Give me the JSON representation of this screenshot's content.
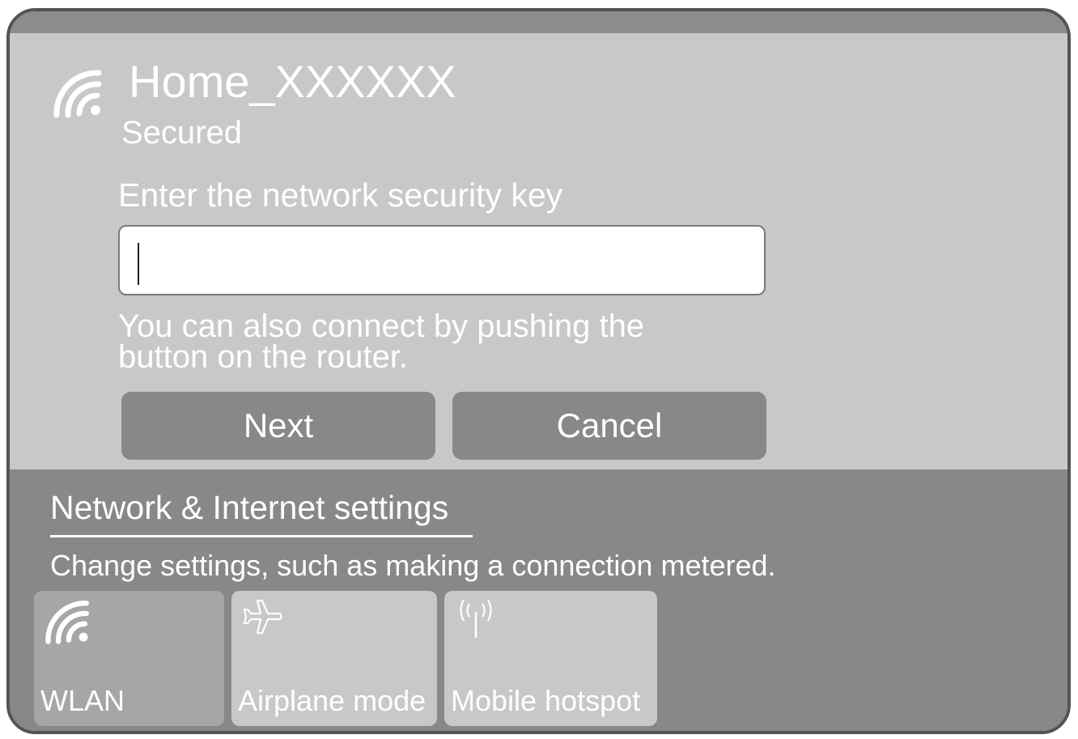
{
  "network": {
    "ssid": "Home_XXXXXX",
    "status": "Secured",
    "prompt": "Enter the network security key",
    "key_value": "",
    "hint": "You can also connect by pushing the button on the router.",
    "icon": "wifi-icon"
  },
  "buttons": {
    "next_label": "Next",
    "cancel_label": "Cancel"
  },
  "settings": {
    "link_label": "Network & Internet settings",
    "description": "Change settings, such as making a connection metered."
  },
  "quick_actions": [
    {
      "label": "WLAN",
      "icon": "wifi-icon",
      "active": true
    },
    {
      "label": "Airplane mode",
      "icon": "airplane-icon",
      "active": false
    },
    {
      "label": "Mobile hotspot",
      "icon": "hotspot-icon",
      "active": false
    }
  ],
  "colors": {
    "panel": "#c8c8c8",
    "bottom_bar": "#888888",
    "button": "#888888",
    "active_tile": "#a6a6a6",
    "border": "#545454"
  }
}
